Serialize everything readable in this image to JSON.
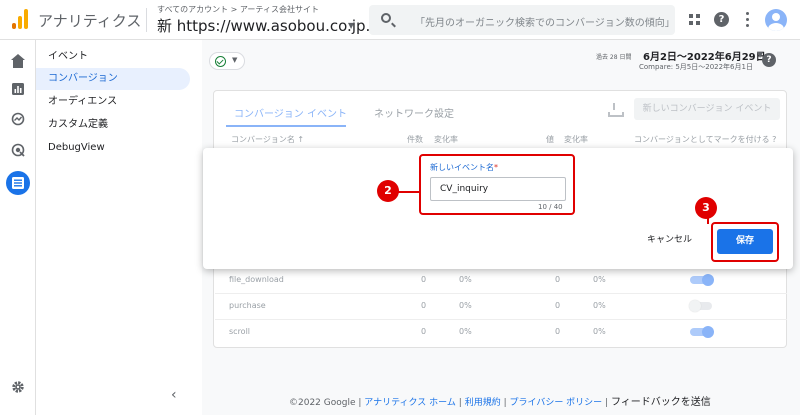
{
  "header": {
    "app_name": "アナリティクス",
    "account_path": "すべてのアカウント > アーティス会社サイト",
    "property": "新 https://www.asobou.co.jp...",
    "search_placeholder": "「先月のオーガニック検索でのコンバージョン数の傾向」..."
  },
  "nav": {
    "items": [
      "イベント",
      "コンバージョン",
      "オーディエンス",
      "カスタム定義",
      "DebugView"
    ],
    "collapse": "‹"
  },
  "main": {
    "date_label": "過去 28 日間",
    "date_range": "6月2日～2022年6月29日",
    "compare": "Compare: 5月5日～2022年6月1日",
    "help": "?"
  },
  "card": {
    "tabs": [
      "コンバージョン イベント",
      "ネットワーク設定"
    ],
    "new_event_button": "新しいコンバージョン イベント",
    "columns": [
      "コンバージョン名 ↑",
      "件数",
      "変化率",
      "値",
      "変化率",
      "コンバージョンとしてマークを付ける ?"
    ],
    "rows": [
      {
        "name": "file_download",
        "count": "0",
        "change": "0%",
        "value": "0",
        "value_change": "0%",
        "toggle": "on"
      },
      {
        "name": "purchase",
        "count": "0",
        "change": "0%",
        "value": "0",
        "value_change": "0%",
        "toggle": "off"
      },
      {
        "name": "scroll",
        "count": "0",
        "change": "0%",
        "value": "0",
        "value_change": "0%",
        "toggle": "on"
      }
    ]
  },
  "dialog": {
    "field_label": "新しいイベント名",
    "required_mark": "*",
    "field_value": "CV_inquiry",
    "char_count": "10 / 40",
    "cancel": "キャンセル",
    "save": "保存"
  },
  "annotations": {
    "step2": "2",
    "step3": "3"
  },
  "footer": {
    "copyright": "©2022 Google |",
    "link_home": "アナリティクス ホーム",
    "sep1": "|",
    "link_terms": "利用規約",
    "sep2": "|",
    "link_privacy": "プライバシー ポリシー",
    "sep3": "|",
    "feedback": "フィードバックを送信"
  },
  "colors": {
    "accent": "#1a73e8",
    "annotation": "#e00000",
    "nav_active_bg": "#e8f0fe"
  }
}
